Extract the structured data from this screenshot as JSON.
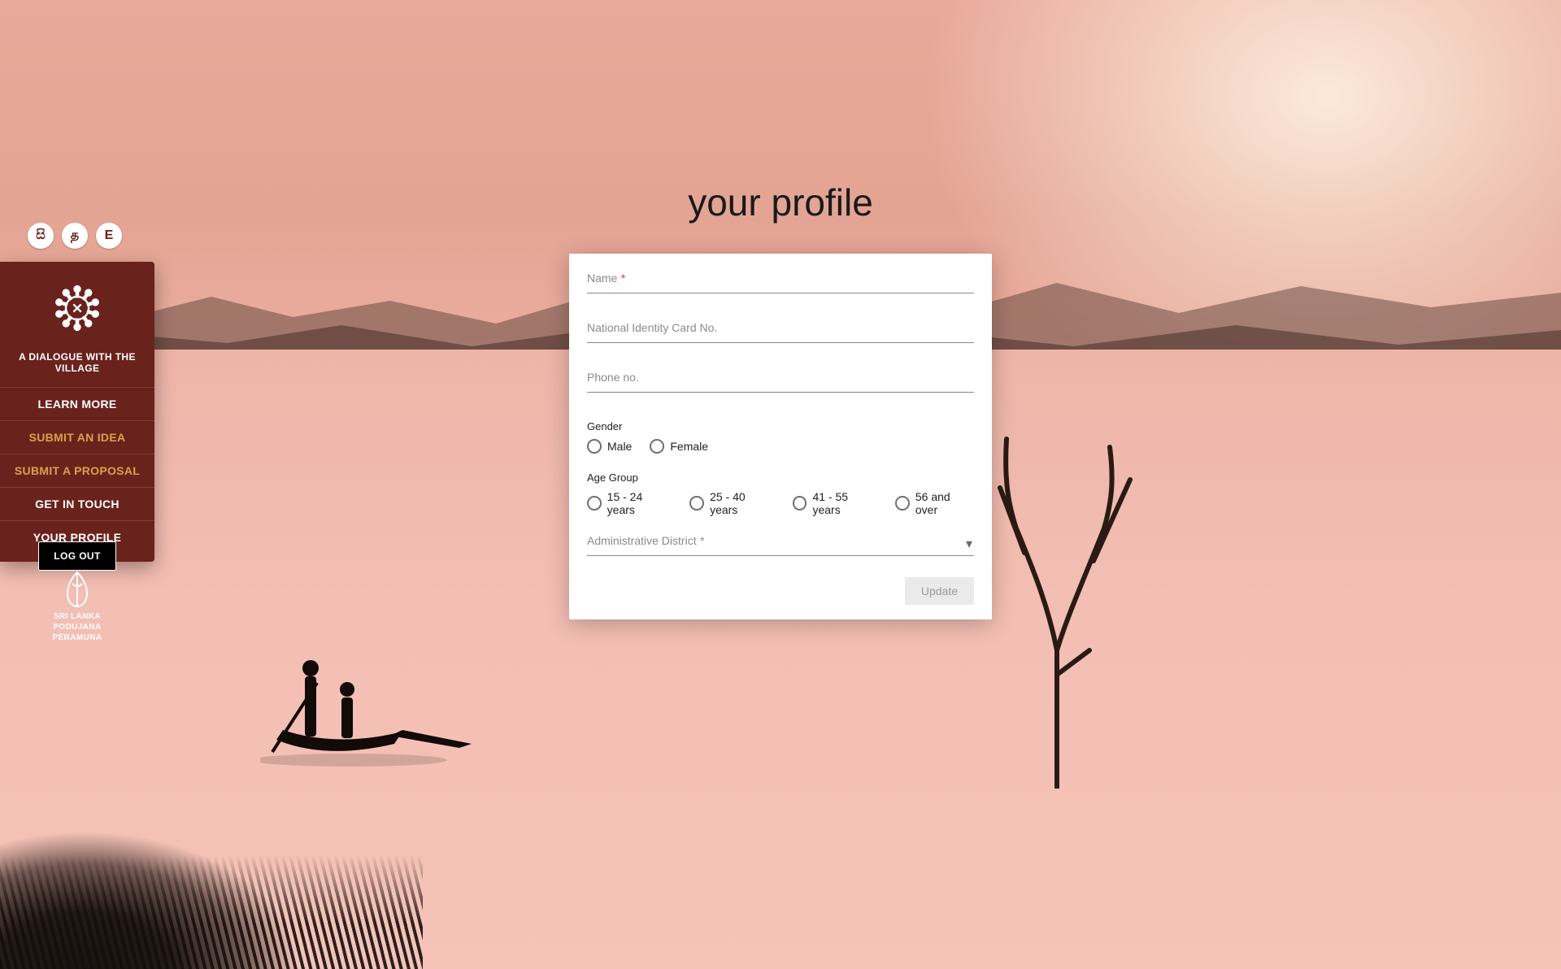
{
  "lang_buttons": [
    "සි",
    "த",
    "E"
  ],
  "sidebar": {
    "tagline": "A DIALOGUE WITH THE VILLAGE",
    "items": [
      {
        "label": "LEARN MORE",
        "alt": false
      },
      {
        "label": "SUBMIT AN IDEA",
        "alt": true
      },
      {
        "label": "SUBMIT A PROPOSAL",
        "alt": true
      },
      {
        "label": "GET IN TOUCH",
        "alt": false
      },
      {
        "label": "YOUR PROFILE",
        "alt": false
      }
    ],
    "logout": "LOG OUT",
    "party_line1": "SRI LANKA",
    "party_line2": "PODUJANA",
    "party_line3": "PERAMUNA"
  },
  "page_title": "your profile",
  "form": {
    "name_label": "Name",
    "nic_label": "National Identity Card No.",
    "phone_label": "Phone no.",
    "gender_label": "Gender",
    "gender_options": [
      "Male",
      "Female"
    ],
    "age_label": "Age Group",
    "age_options": [
      "15 - 24 years",
      "25 - 40 years",
      "41 - 55 years",
      "56 and over"
    ],
    "district_label": "Administrative District",
    "update_btn": "Update",
    "required_marker": "*"
  }
}
